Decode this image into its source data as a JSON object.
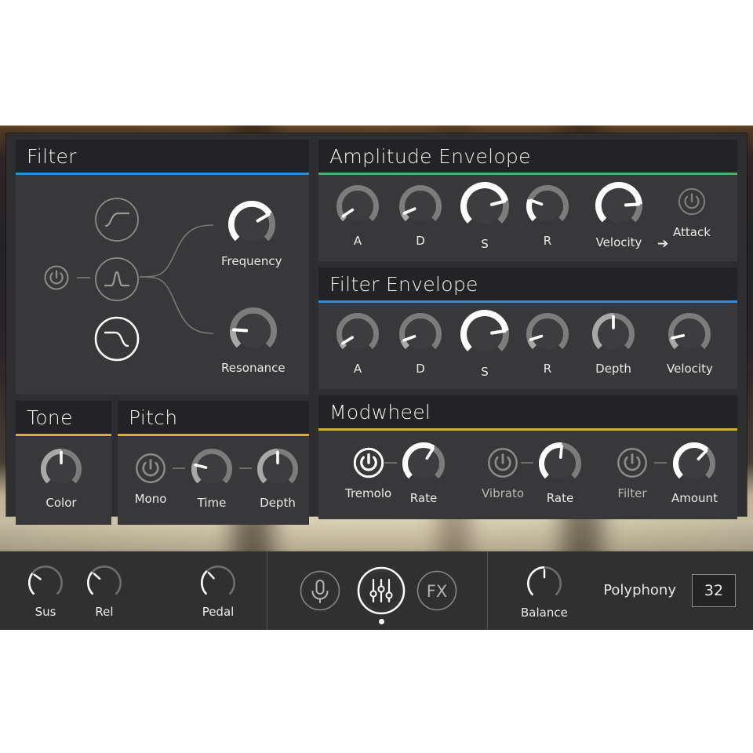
{
  "app": {
    "accent_blue": "#2b8fe0",
    "accent_green": "#4caf72",
    "accent_gold": "#d4ad3a"
  },
  "filter": {
    "title": "Filter",
    "accent": "#2b8fe0",
    "power": {
      "name": "filter-power-toggle",
      "enabled": false
    },
    "types": [
      {
        "id": "highpass",
        "label": "highpass-filter-icon",
        "selected": false
      },
      {
        "id": "bandpass",
        "label": "bandpass-filter-icon",
        "selected": false
      },
      {
        "id": "lowpass",
        "label": "lowpass-filter-icon",
        "selected": true
      }
    ],
    "knobs": [
      {
        "label": "Frequency",
        "value": 72,
        "bright": true
      },
      {
        "label": "Resonance",
        "value": 18,
        "bright": false
      }
    ]
  },
  "amplitude_envelope": {
    "title": "Amplitude Envelope",
    "accent": "#4caf72",
    "knobs": [
      {
        "label": "A",
        "value": 4,
        "bright": false
      },
      {
        "label": "D",
        "value": 8,
        "bright": false
      },
      {
        "label": "S",
        "value": 78,
        "bright": true
      },
      {
        "label": "R",
        "value": 24,
        "bright": true
      },
      {
        "label": "Velocity",
        "value": 82,
        "bright": true
      }
    ],
    "arrow": "➔",
    "target_label": "Attack",
    "target_power": {
      "name": "velocity-attack-power-toggle",
      "enabled": false
    }
  },
  "filter_envelope": {
    "title": "Filter Envelope",
    "accent": "#2b8fe0",
    "knobs": [
      {
        "label": "A",
        "value": 5,
        "bright": false
      },
      {
        "label": "D",
        "value": 9,
        "bright": false
      },
      {
        "label": "S",
        "value": 80,
        "bright": true
      },
      {
        "label": "R",
        "value": 10,
        "bright": false
      },
      {
        "label": "Depth",
        "value": 50,
        "bright": false
      },
      {
        "label": "Velocity",
        "value": 12,
        "bright": false
      }
    ]
  },
  "tone": {
    "title": "Tone",
    "accent": "#d4ad3a",
    "knobs": [
      {
        "label": "Color",
        "value": 50,
        "bright": false
      }
    ]
  },
  "pitch": {
    "title": "Pitch",
    "accent": "#d4ad3a",
    "mono": {
      "label": "Mono",
      "enabled": false
    },
    "knobs": [
      {
        "label": "Time",
        "value": 22,
        "bright": false
      },
      {
        "label": "Depth",
        "value": 50,
        "bright": false
      }
    ]
  },
  "modwheel": {
    "title": "Modwheel",
    "accent": "#d4ad3a",
    "groups": [
      {
        "toggle": {
          "label": "Tremolo",
          "enabled": true
        },
        "knob": {
          "label": "Rate",
          "value": 62,
          "bright": true
        }
      },
      {
        "toggle": {
          "label": "Vibrato",
          "enabled": false
        },
        "knob": {
          "label": "Rate",
          "value": 52,
          "bright": true
        }
      },
      {
        "toggle": {
          "label": "Filter",
          "enabled": false
        },
        "knob": {
          "label": "Amount",
          "value": 66,
          "bright": true
        }
      }
    ]
  },
  "toolbar": {
    "pedal_knobs": [
      {
        "label": "Sus",
        "value": 30
      },
      {
        "label": "Rel",
        "value": 32
      },
      {
        "label": "Pedal",
        "value": 34
      }
    ],
    "tabs": [
      {
        "id": "mic",
        "icon": "microphone-icon",
        "active": false
      },
      {
        "id": "mixer",
        "icon": "sliders-icon",
        "active": true
      },
      {
        "id": "fx",
        "icon": "FX",
        "active": false
      }
    ],
    "balance": {
      "label": "Balance",
      "value": 50
    },
    "polyphony": {
      "label": "Polyphony",
      "value": "32"
    }
  }
}
